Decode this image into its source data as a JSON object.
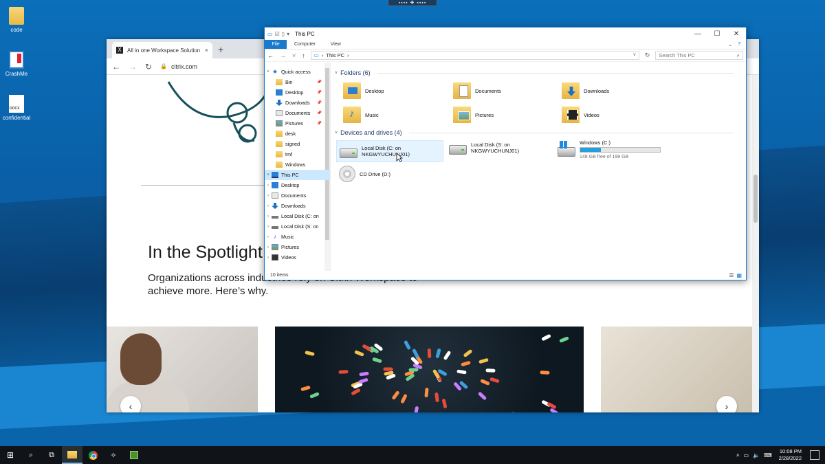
{
  "desktop": {
    "icons": [
      {
        "label": "code",
        "icon": "folder-icon"
      },
      {
        "label": "CrashMe",
        "icon": "app-icon"
      },
      {
        "label": "confidential",
        "icon": "docx-icon"
      }
    ]
  },
  "browser": {
    "tab_title": "All in one Workspace Solution fo",
    "tab_close": "×",
    "new_tab": "+",
    "url": "citrix.com",
    "page": {
      "spotlight_title": "In the Spotlight",
      "spotlight_sub": "Organizations across industries rely on Citrix Workspace to achieve more. Here’s why.",
      "carousel_prev": "‹",
      "carousel_next": "›"
    }
  },
  "explorer": {
    "title": "This PC",
    "ribbon": {
      "file": "File",
      "computer": "Computer",
      "view": "View"
    },
    "address_path": "This PC",
    "search_placeholder": "Search This PC",
    "nav": [
      {
        "label": "Quick access",
        "icon": "star-icon",
        "expand": "˅",
        "level": 0
      },
      {
        "label": "Bin",
        "icon": "folder-icon",
        "pinned": true
      },
      {
        "label": "Desktop",
        "icon": "desktop-icon",
        "pinned": true
      },
      {
        "label": "Downloads",
        "icon": "downloads-icon",
        "pinned": true
      },
      {
        "label": "Documents",
        "icon": "documents-icon",
        "pinned": true
      },
      {
        "label": "Pictures",
        "icon": "pictures-icon",
        "pinned": true
      },
      {
        "label": "desk",
        "icon": "folder-icon"
      },
      {
        "label": "signed",
        "icon": "folder-icon"
      },
      {
        "label": "tmf",
        "icon": "folder-icon"
      },
      {
        "label": "Windows",
        "icon": "folder-icon"
      },
      {
        "label": "This PC",
        "icon": "pc-icon",
        "expand": "˅",
        "selected": true
      },
      {
        "label": "Desktop",
        "icon": "desktop-icon",
        "expand": "›"
      },
      {
        "label": "Documents",
        "icon": "documents-icon",
        "expand": "›"
      },
      {
        "label": "Downloads",
        "icon": "downloads-icon",
        "expand": "›"
      },
      {
        "label": "Local Disk (C: on",
        "icon": "disk-icon",
        "expand": "›"
      },
      {
        "label": "Local Disk (S: on",
        "icon": "disk-icon",
        "expand": "›"
      },
      {
        "label": "Music",
        "icon": "music-icon",
        "expand": "›"
      },
      {
        "label": "Pictures",
        "icon": "pictures-icon",
        "expand": "›"
      },
      {
        "label": "Videos",
        "icon": "videos-icon",
        "expand": "›"
      }
    ],
    "folders_header": "Folders (6)",
    "folders": [
      {
        "label": "Desktop",
        "kind": "desk"
      },
      {
        "label": "Documents",
        "kind": "docs"
      },
      {
        "label": "Downloads",
        "kind": "dl"
      },
      {
        "label": "Music",
        "kind": "music"
      },
      {
        "label": "Pictures",
        "kind": "pics"
      },
      {
        "label": "Videos",
        "kind": "vids"
      }
    ],
    "drives_header": "Devices and drives (4)",
    "drives": {
      "c_line1": "Local Disk (C: on",
      "c_line2": "NKGWYUCHUNJ01)",
      "s_line1": "Local Disk (S: on",
      "s_line2": "NKGWYUCHUNJ01)",
      "win_name": "Windows (C:)",
      "win_free": "148 GB free of 199 GB",
      "win_used_fraction": 0.256,
      "cd_name": "CD Drive (D:)"
    },
    "status": "10 items"
  },
  "taskbar": {
    "time": "10:08 PM",
    "date": "2/28/2022"
  },
  "colors": {
    "accent": "#1979ca",
    "selection": "#cce8ff",
    "usage_bar": "#26a0da"
  }
}
